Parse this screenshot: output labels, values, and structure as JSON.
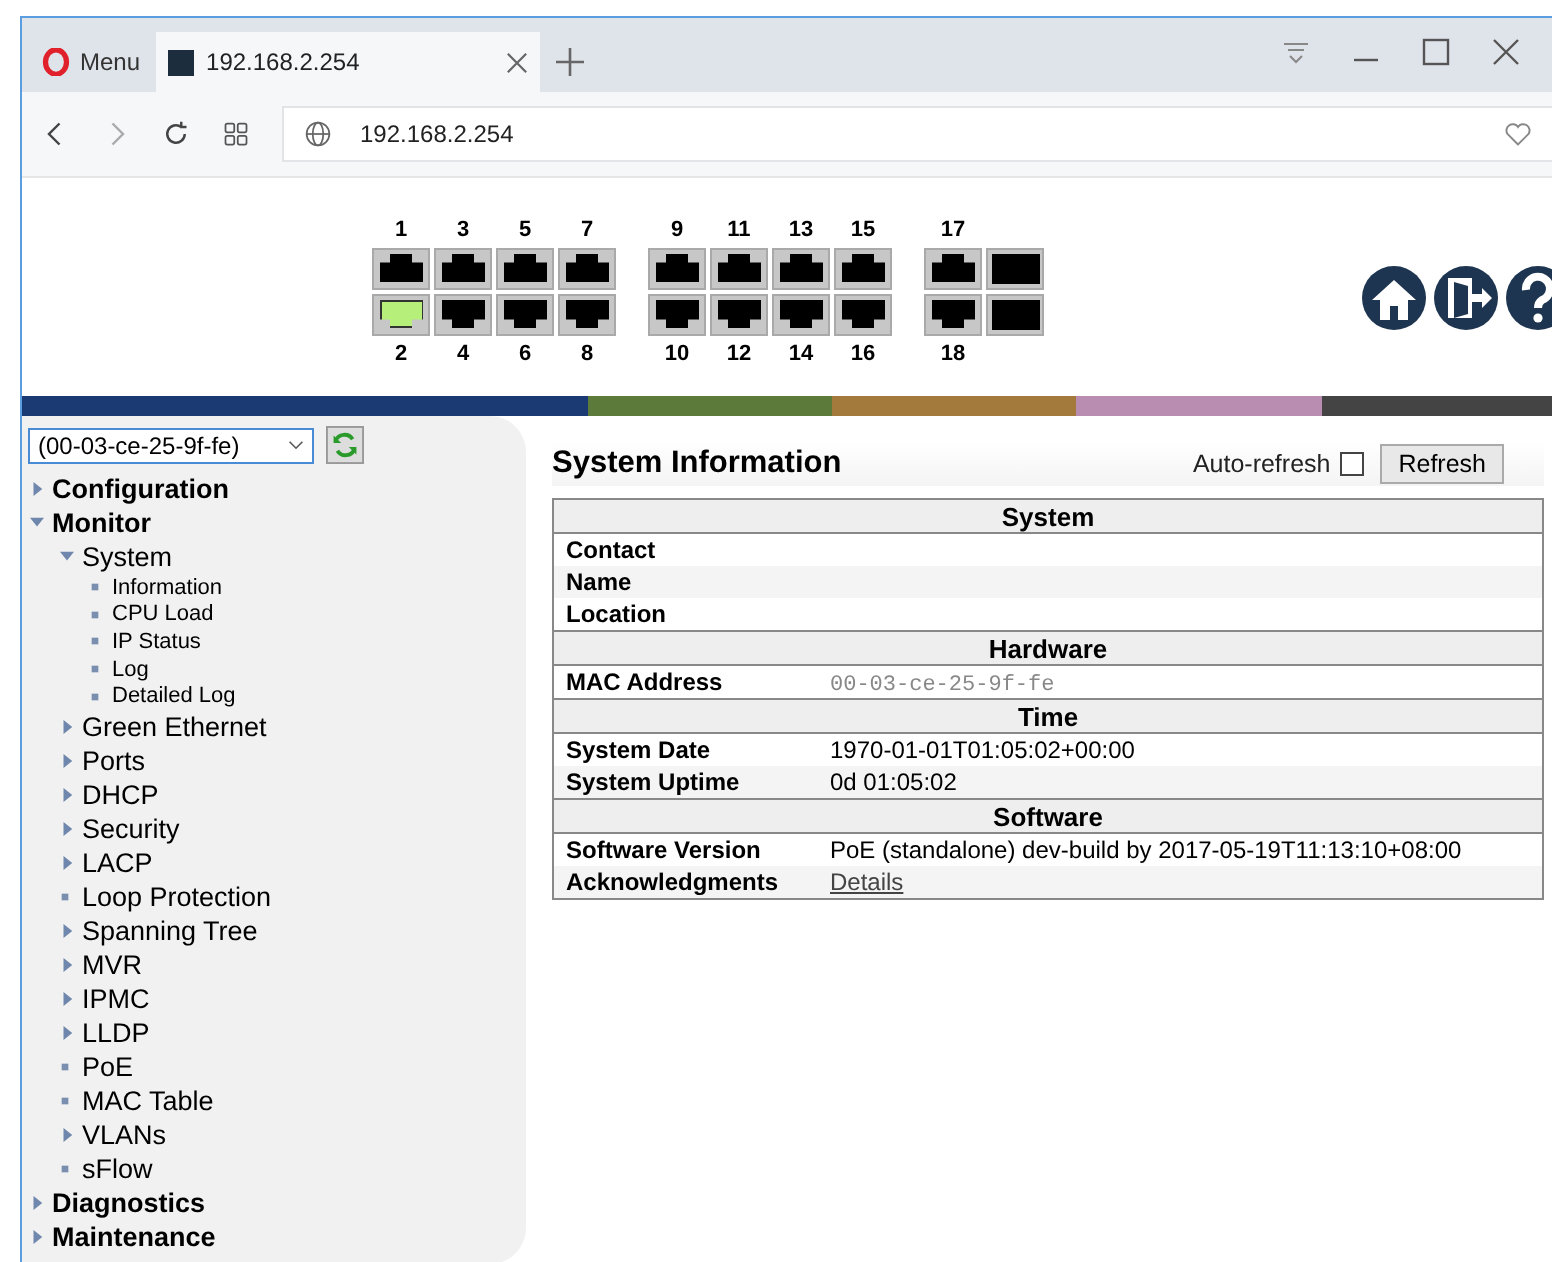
{
  "browser": {
    "menu_label": "Menu",
    "tabs": [
      {
        "title": "192.168.2.254",
        "selected": true
      }
    ],
    "address": "192.168.2.254"
  },
  "switch_panel": {
    "columns": [
      {
        "top": {
          "label": "1",
          "link": false
        },
        "bottom": {
          "label": "2",
          "link": true
        }
      },
      {
        "top": {
          "label": "3",
          "link": false
        },
        "bottom": {
          "label": "4",
          "link": false
        }
      },
      {
        "top": {
          "label": "5",
          "link": false
        },
        "bottom": {
          "label": "6",
          "link": false
        }
      },
      {
        "top": {
          "label": "7",
          "link": false
        },
        "bottom": {
          "label": "8",
          "link": false
        }
      },
      {
        "gap": true,
        "top": {
          "label": "9",
          "link": false
        },
        "bottom": {
          "label": "10",
          "link": false
        }
      },
      {
        "top": {
          "label": "11",
          "link": false
        },
        "bottom": {
          "label": "12",
          "link": false
        }
      },
      {
        "top": {
          "label": "13",
          "link": false
        },
        "bottom": {
          "label": "14",
          "link": false
        }
      },
      {
        "top": {
          "label": "15",
          "link": false
        },
        "bottom": {
          "label": "16",
          "link": false
        }
      },
      {
        "gap": true,
        "top": {
          "label": "17",
          "link": false
        },
        "bottom": {
          "label": "18",
          "link": false
        }
      },
      {
        "kind": "sfp"
      }
    ]
  },
  "sidebar": {
    "device_select": "(00-03-ce-25-9f-fe)",
    "tree": [
      {
        "label": "Configuration",
        "expanded": false
      },
      {
        "label": "Monitor",
        "expanded": true,
        "children": [
          {
            "label": "System",
            "expanded": true,
            "children": [
              {
                "label": "Information",
                "kind": "page"
              },
              {
                "label": "CPU Load",
                "kind": "page"
              },
              {
                "label": "IP Status",
                "kind": "page"
              },
              {
                "label": "Log",
                "kind": "page"
              },
              {
                "label": "Detailed Log",
                "kind": "page"
              }
            ]
          },
          {
            "label": "Green Ethernet",
            "expanded": false
          },
          {
            "label": "Ports",
            "expanded": false
          },
          {
            "label": "DHCP",
            "expanded": false
          },
          {
            "label": "Security",
            "expanded": false
          },
          {
            "label": "LACP",
            "expanded": false
          },
          {
            "label": "Loop Protection",
            "kind": "page"
          },
          {
            "label": "Spanning Tree",
            "expanded": false
          },
          {
            "label": "MVR",
            "expanded": false
          },
          {
            "label": "IPMC",
            "expanded": false
          },
          {
            "label": "LLDP",
            "expanded": false
          },
          {
            "label": "PoE",
            "kind": "page"
          },
          {
            "label": "MAC Table",
            "kind": "page"
          },
          {
            "label": "VLANs",
            "expanded": false
          },
          {
            "label": "sFlow",
            "kind": "page"
          }
        ]
      },
      {
        "label": "Diagnostics",
        "expanded": false
      },
      {
        "label": "Maintenance",
        "expanded": false
      }
    ]
  },
  "main": {
    "title": "System Information",
    "auto_refresh": {
      "label": "Auto-refresh",
      "checked": false
    },
    "refresh_button": "Refresh",
    "sections": [
      {
        "heading": "System",
        "rows": [
          {
            "label": "Contact"
          },
          {
            "label": "Name"
          },
          {
            "label": "Location"
          }
        ]
      },
      {
        "heading": "Hardware",
        "rows": [
          {
            "label": "MAC Address",
            "value": "00-03-ce-25-9f-fe",
            "kind": "mono"
          }
        ]
      },
      {
        "heading": "Time",
        "rows": [
          {
            "label": "System Date",
            "value": "1970-01-01T01:05:02+00:00",
            "kind": "text"
          },
          {
            "label": "System Uptime",
            "value": "0d 01:05:02",
            "kind": "text"
          }
        ]
      },
      {
        "heading": "Software",
        "rows": [
          {
            "label": "Software Version",
            "value": "PoE (standalone) dev-build by 2017-05-19T11:13:10+08:00",
            "kind": "text"
          },
          {
            "label": "Acknowledgments",
            "value": "Details",
            "kind": "link"
          }
        ]
      }
    ]
  }
}
